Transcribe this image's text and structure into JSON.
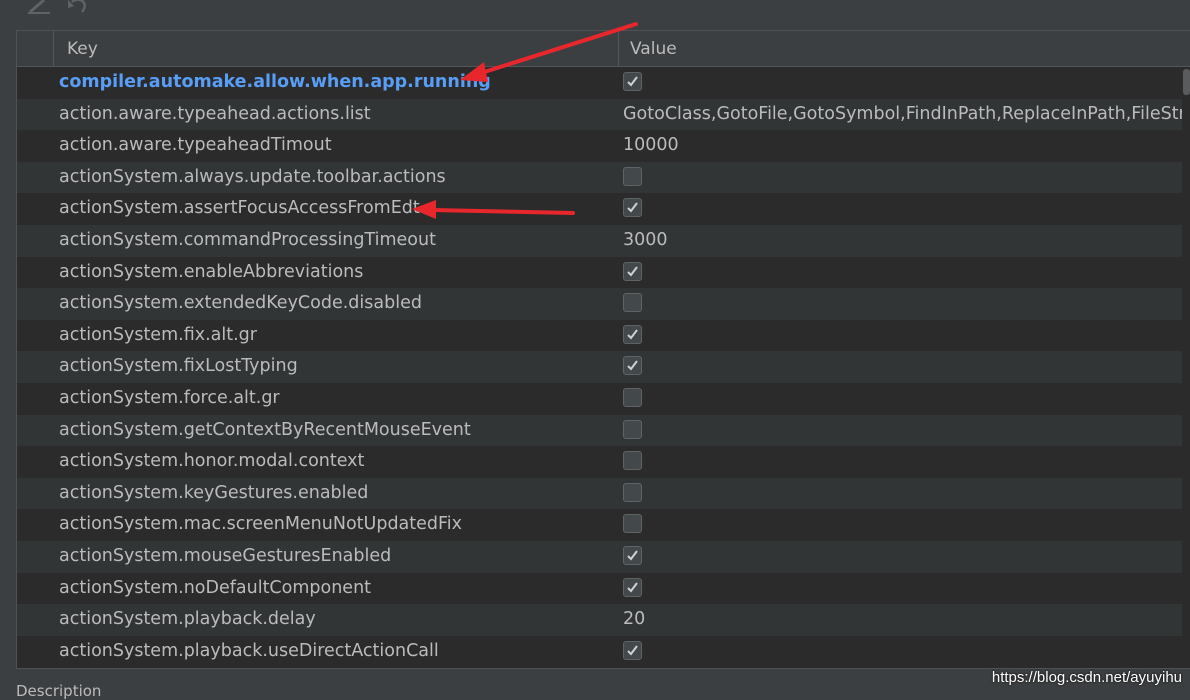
{
  "toolbar": {
    "icons": [
      "edit-icon",
      "revert-icon"
    ]
  },
  "table": {
    "headers": {
      "key": "Key",
      "value": "Value"
    },
    "rows": [
      {
        "key": "compiler.automake.allow.when.app.running",
        "type": "bool",
        "value": true,
        "highlighted": true
      },
      {
        "key": "action.aware.typeahead.actions.list",
        "type": "text",
        "value": "GotoClass,GotoFile,GotoSymbol,FindInPath,ReplaceInPath,FileStru"
      },
      {
        "key": "action.aware.typeaheadTimout",
        "type": "text",
        "value": "10000"
      },
      {
        "key": "actionSystem.always.update.toolbar.actions",
        "type": "bool",
        "value": false
      },
      {
        "key": "actionSystem.assertFocusAccessFromEdt",
        "type": "bool",
        "value": true
      },
      {
        "key": "actionSystem.commandProcessingTimeout",
        "type": "text",
        "value": "3000"
      },
      {
        "key": "actionSystem.enableAbbreviations",
        "type": "bool",
        "value": true
      },
      {
        "key": "actionSystem.extendedKeyCode.disabled",
        "type": "bool",
        "value": false
      },
      {
        "key": "actionSystem.fix.alt.gr",
        "type": "bool",
        "value": true
      },
      {
        "key": "actionSystem.fixLostTyping",
        "type": "bool",
        "value": true
      },
      {
        "key": "actionSystem.force.alt.gr",
        "type": "bool",
        "value": false
      },
      {
        "key": "actionSystem.getContextByRecentMouseEvent",
        "type": "bool",
        "value": false
      },
      {
        "key": "actionSystem.honor.modal.context",
        "type": "bool",
        "value": false
      },
      {
        "key": "actionSystem.keyGestures.enabled",
        "type": "bool",
        "value": false
      },
      {
        "key": "actionSystem.mac.screenMenuNotUpdatedFix",
        "type": "bool",
        "value": false
      },
      {
        "key": "actionSystem.mouseGesturesEnabled",
        "type": "bool",
        "value": true
      },
      {
        "key": "actionSystem.noDefaultComponent",
        "type": "bool",
        "value": true
      },
      {
        "key": "actionSystem.playback.delay",
        "type": "text",
        "value": "20"
      },
      {
        "key": "actionSystem.playback.useDirectActionCall",
        "type": "bool",
        "value": true
      }
    ]
  },
  "description_label": "Description",
  "watermark": "https://blog.csdn.net/ayuyihu",
  "colors": {
    "highlight_key": "#589df6",
    "annotation_arrow": "#e8272d",
    "background": "#2b2b2b",
    "alt_row": "#323536"
  }
}
